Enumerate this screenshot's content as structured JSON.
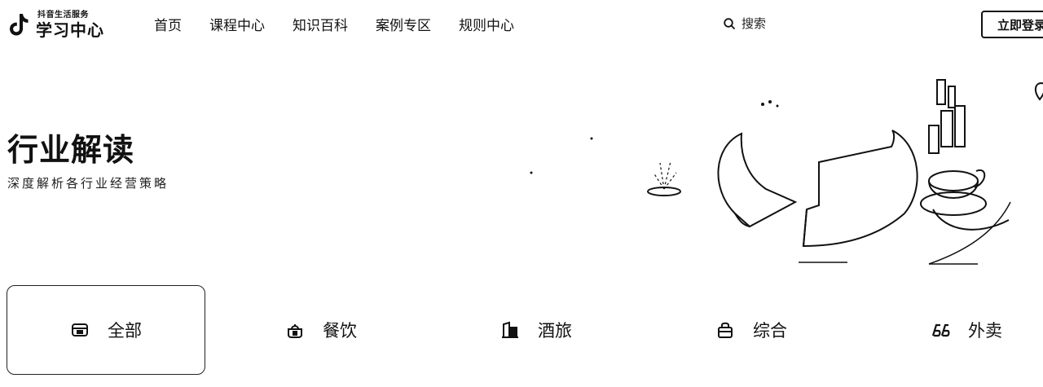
{
  "header": {
    "logo": {
      "sub": "抖音生活服务",
      "main": "学习中心"
    },
    "nav": [
      {
        "label": "首页"
      },
      {
        "label": "课程中心"
      },
      {
        "label": "知识百科"
      },
      {
        "label": "案例专区"
      },
      {
        "label": "规则中心"
      }
    ],
    "search": {
      "label": "搜索",
      "icon": "search-icon"
    },
    "login": {
      "label": "立即登录"
    }
  },
  "hero": {
    "title": "行业解读",
    "subtitle": "深度解析各行业经营策略"
  },
  "categories": [
    {
      "label": "全部",
      "icon": "all-icon",
      "active": true
    },
    {
      "label": "餐饮",
      "icon": "food-icon",
      "active": false
    },
    {
      "label": "酒旅",
      "icon": "hotel-icon",
      "active": false
    },
    {
      "label": "综合",
      "icon": "bag-icon",
      "active": false
    },
    {
      "label": "外卖",
      "icon": "delivery-icon",
      "active": false
    }
  ]
}
